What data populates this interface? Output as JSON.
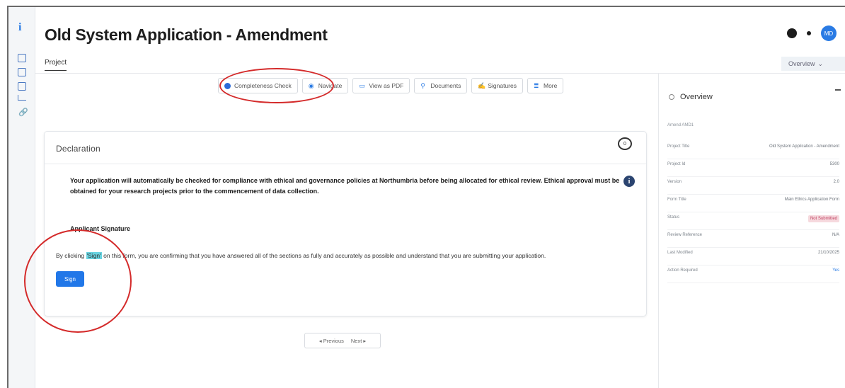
{
  "header": {
    "title": "Old System Application - Amendment",
    "avatar_initials": "MD"
  },
  "tabs": {
    "project": "Project",
    "overview_dropdown": "Overview"
  },
  "toolbar": {
    "completeness_check": "Completeness Check",
    "navigate": "Navigate",
    "view_as_pdf": "View as PDF",
    "documents": "Documents",
    "signatures": "Signatures",
    "more": "More"
  },
  "declaration": {
    "title": "Declaration",
    "comment_count": "0",
    "notice": "Your application will automatically be checked for compliance with ethical and governance policies at Northumbria before being allocated for ethical review. Ethical approval must be obtained for your research projects prior to the commencement of data collection.",
    "signature_heading": "Applicant Signature",
    "sig_text_before": "By clicking ",
    "sig_text_highlight": "'Sign'",
    "sig_text_after": " on this form, you are confirming that you have answered all of the sections as fully and accurately as possible and understand that you are submitting your application.",
    "sign_button": "Sign"
  },
  "pager": {
    "previous": "◂ Previous",
    "next": "Next ▸"
  },
  "overview_panel": {
    "title": "Overview",
    "subtitle": "Amend AMD1",
    "rows": [
      {
        "label": "Project Title",
        "value": "Old System Application - Amendment"
      },
      {
        "label": "Project Id",
        "value": "5300"
      },
      {
        "label": "Version",
        "value": "2.0"
      },
      {
        "label": "Form Title",
        "value": "Main Ethics Application Form"
      },
      {
        "label": "Status",
        "value": "Not Submitted"
      },
      {
        "label": "Review Reference",
        "value": "N/A"
      },
      {
        "label": "Last Modified",
        "value": "21/10/2025"
      },
      {
        "label": "Action Required",
        "value": "Yes"
      }
    ]
  },
  "colors": {
    "accent": "#2177e8",
    "annotation_ring": "#d42a2a",
    "status_badge": "#f6d9de"
  }
}
